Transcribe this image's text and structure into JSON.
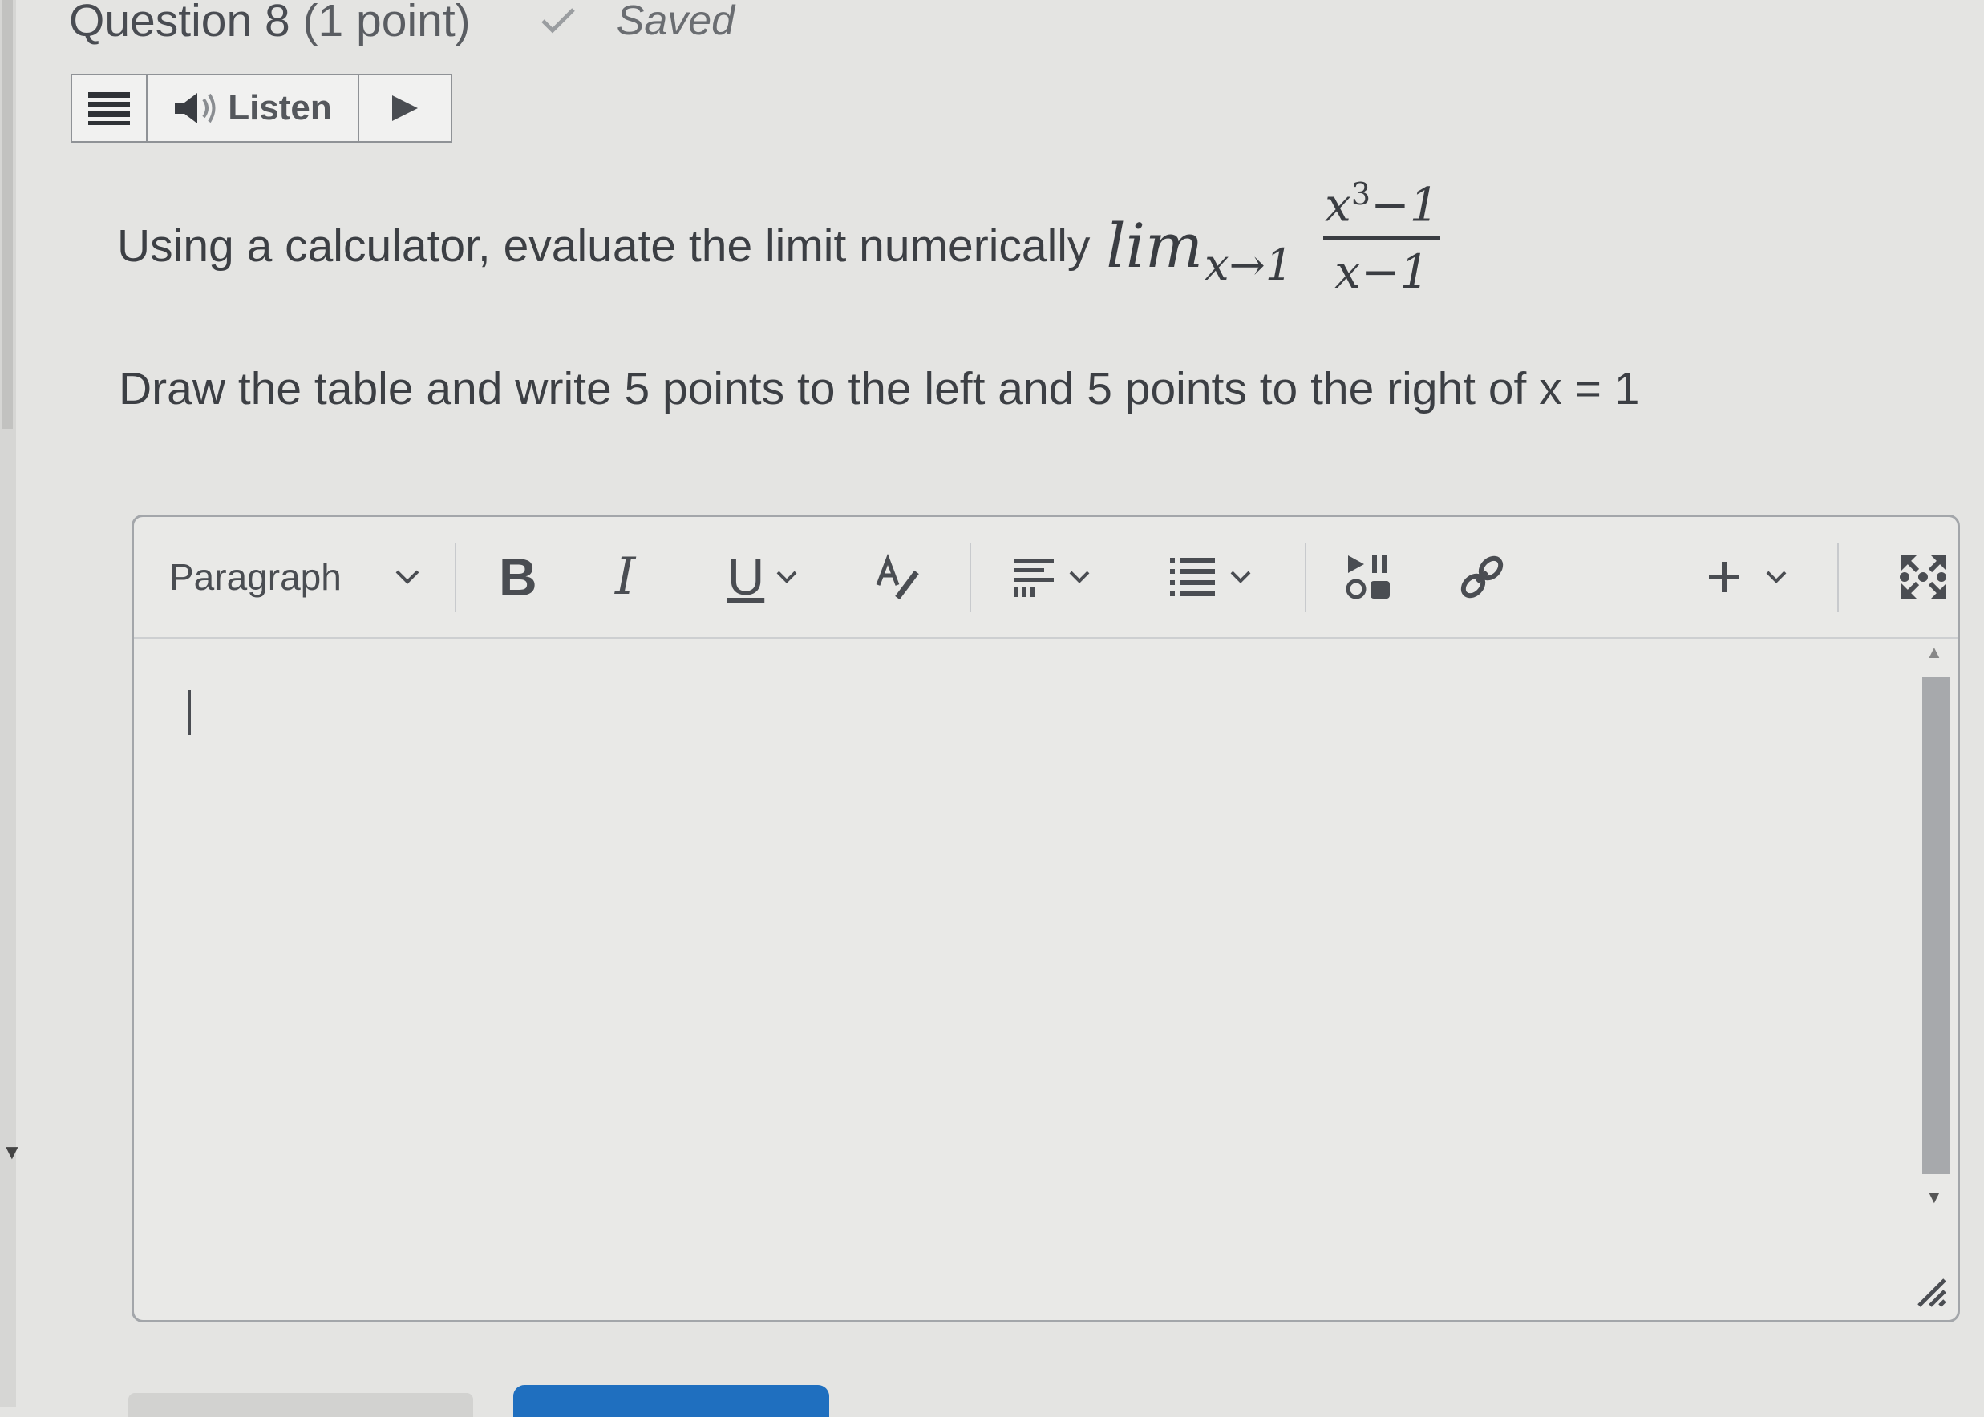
{
  "question": {
    "title": "Question 8",
    "points": "(1 point)",
    "status": "Saved"
  },
  "listen_bar": {
    "label": "Listen"
  },
  "prompt": {
    "text": "Using a calculator, evaluate the limit numerically",
    "lim": "lim",
    "subscript": "x→1",
    "numerator": "x",
    "numerator_exp": "3",
    "numerator_rest": "−1",
    "denominator": "x−1",
    "instruction": "Draw the table and write 5 points to the left and 5 points to the right of x = 1"
  },
  "editor": {
    "format_select": "Paragraph",
    "bold_label": "B",
    "italic_label": "I",
    "underline_label": "U",
    "content": ""
  },
  "colors": {
    "background": "#e4e4e2",
    "text": "#3c3f44",
    "accent": "#1f6fbf"
  }
}
